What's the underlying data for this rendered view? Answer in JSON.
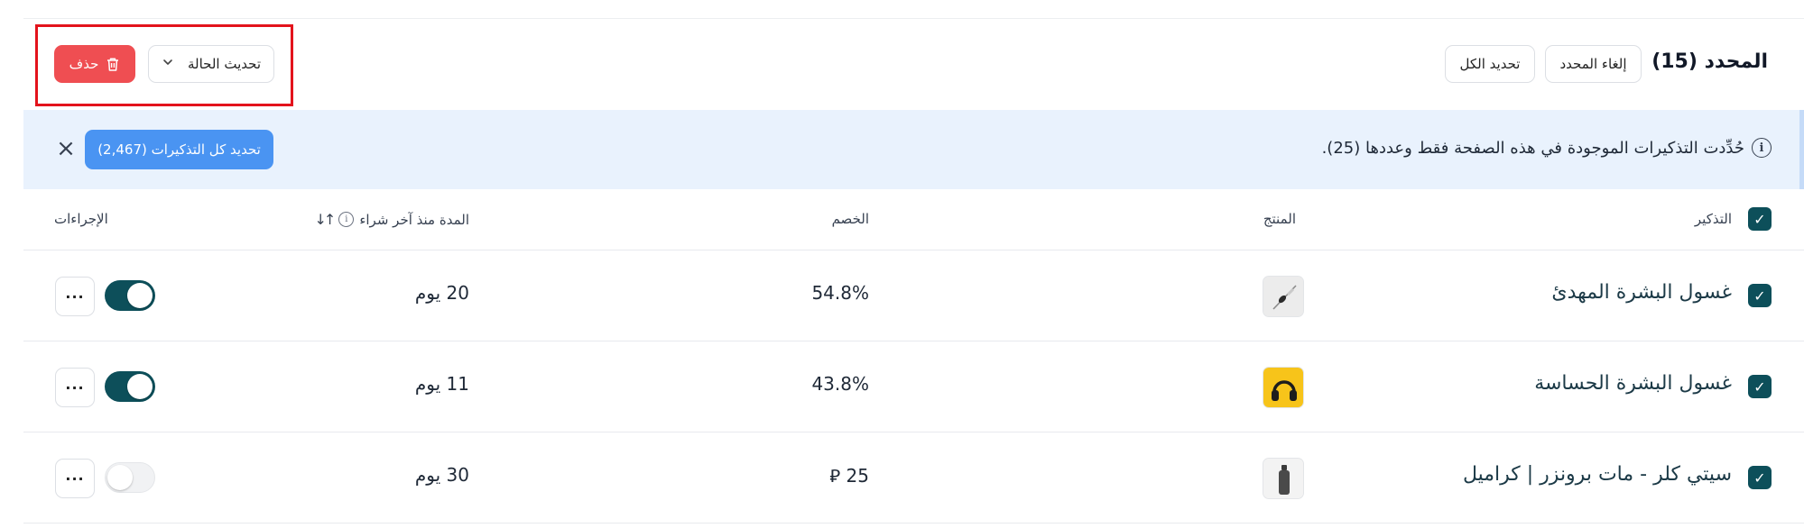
{
  "toolbar": {
    "selected_title": "المحدد (15)",
    "clear_selection_label": "إلغاء المحدد",
    "select_all_label": "تحديد الكل",
    "update_status_label": "تحديث الحالة",
    "delete_label": "حذف"
  },
  "banner": {
    "message": "حُدِّدت التذكيرات الموجودة في هذه الصفحة فقط وعددها (25).",
    "select_all_reminders_label": "تحديد كل التذكيرات (2,467)",
    "close_icon": "×"
  },
  "table": {
    "headers": {
      "reminder": "التذكير",
      "product": "المنتج",
      "discount": "الخصم",
      "since_last_purchase": "المدة منذ آخر شراء",
      "actions": "الإجراءات"
    },
    "rows": [
      {
        "name": "غسول البشرة المهدئ",
        "discount": "54.8%",
        "since": "20 يوم",
        "enabled": true,
        "thumb": "makeup-brush-icon"
      },
      {
        "name": "غسول البشرة الحساسة",
        "discount": "43.8%",
        "since": "11 يوم",
        "enabled": true,
        "thumb": "headphones-icon"
      },
      {
        "name": "سيتي كلر - مات برونزر | كراميل",
        "discount": "25 ⃁",
        "since": "30 يوم",
        "enabled": false,
        "thumb": "bottle-icon"
      }
    ]
  },
  "colors": {
    "accent": "#0d4f5a",
    "danger": "#ef4e52",
    "banner_bg": "#e9f2fd",
    "pill_blue": "#4a94f2",
    "highlight_red": "#e3131c"
  },
  "icons": {
    "checkmark": "✓",
    "chevron": "⌵",
    "more": "···",
    "info": "i",
    "sort": "↑↓"
  }
}
